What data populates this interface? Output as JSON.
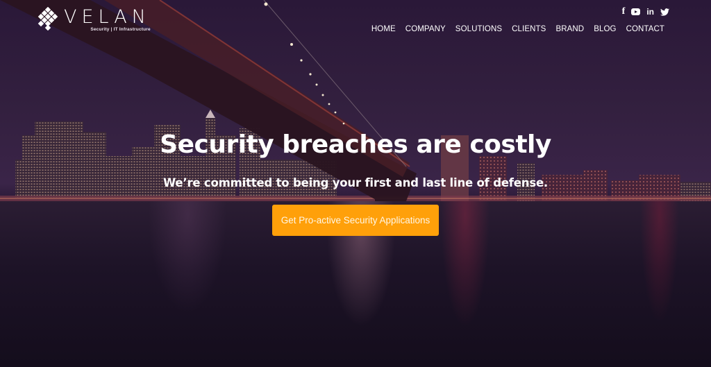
{
  "brand": {
    "name": "VELAN",
    "tagline": "Security | IT Infrastructure"
  },
  "social": [
    {
      "icon": "facebook-icon",
      "glyph": "f"
    },
    {
      "icon": "youtube-icon",
      "glyph": ""
    },
    {
      "icon": "linkedin-icon",
      "glyph": "in"
    },
    {
      "icon": "twitter-icon",
      "glyph": "🐦"
    }
  ],
  "nav": {
    "items": [
      "HOME",
      "COMPANY",
      "SOLUTIONS",
      "CLIENTS",
      "BRAND",
      "BLOG",
      "CONTACT"
    ]
  },
  "hero": {
    "headline": "Security breaches are costly",
    "subheadline": "We’re committed to being your first and last line of defense.",
    "cta_label": "Get Pro-active Security Applications"
  },
  "colors": {
    "accent": "#ffa00a",
    "overlay": "#2a1838",
    "text": "#ffffff"
  }
}
